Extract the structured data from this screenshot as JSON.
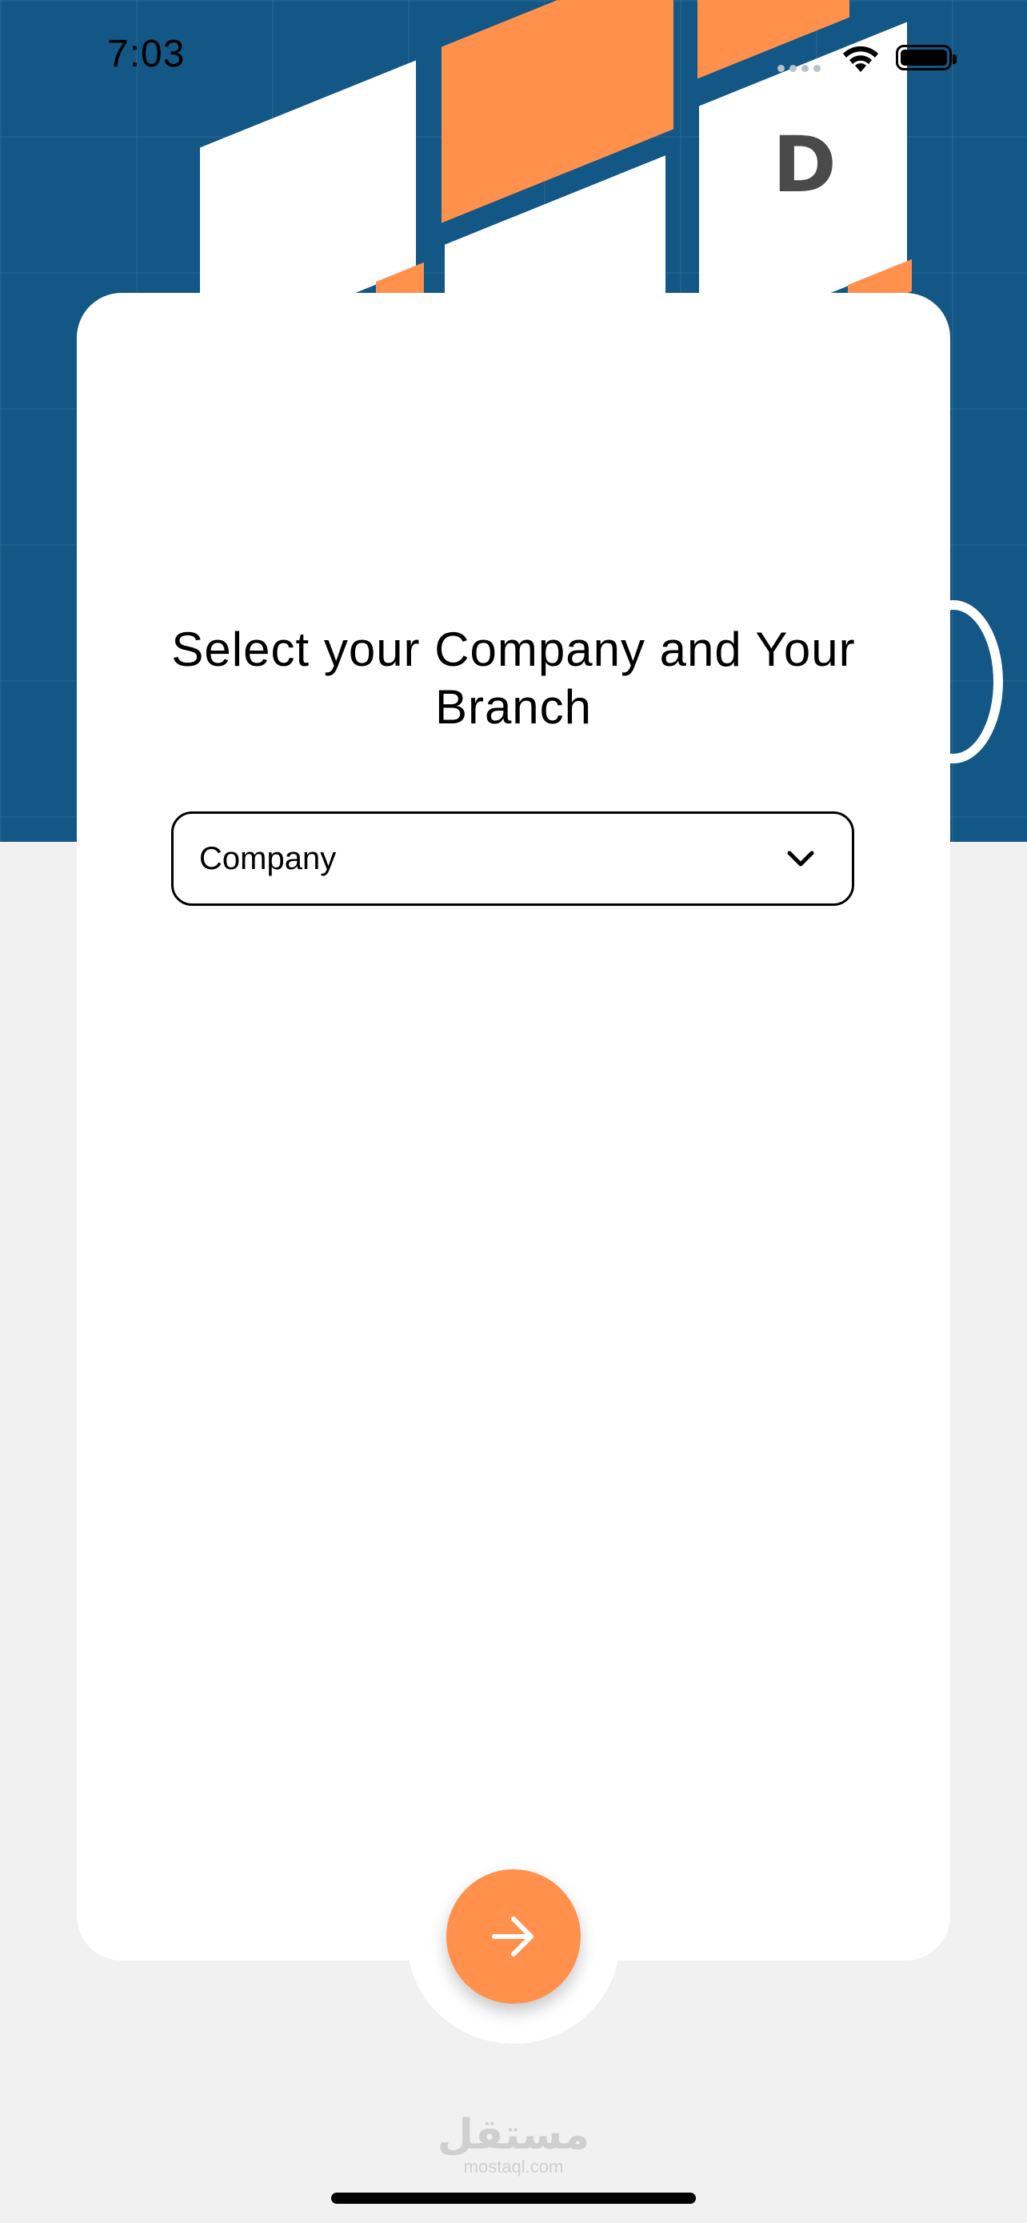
{
  "status_bar": {
    "time": "7:03",
    "wifi_icon": "wifi-icon",
    "battery_icon": "battery-icon",
    "signal_icon": "signal-dots-icon"
  },
  "hero": {
    "letter": "D",
    "colors": {
      "background": "#135786",
      "accent": "#ff914d"
    }
  },
  "card": {
    "title": "Select your Company and Your Branch",
    "company_select": {
      "value": "Company",
      "icon": "chevron-down-icon"
    }
  },
  "next_button": {
    "icon": "arrow-right-icon",
    "color": "#ff914d"
  },
  "watermark": {
    "arabic": "مستقل",
    "latin": "mostaql.com"
  }
}
